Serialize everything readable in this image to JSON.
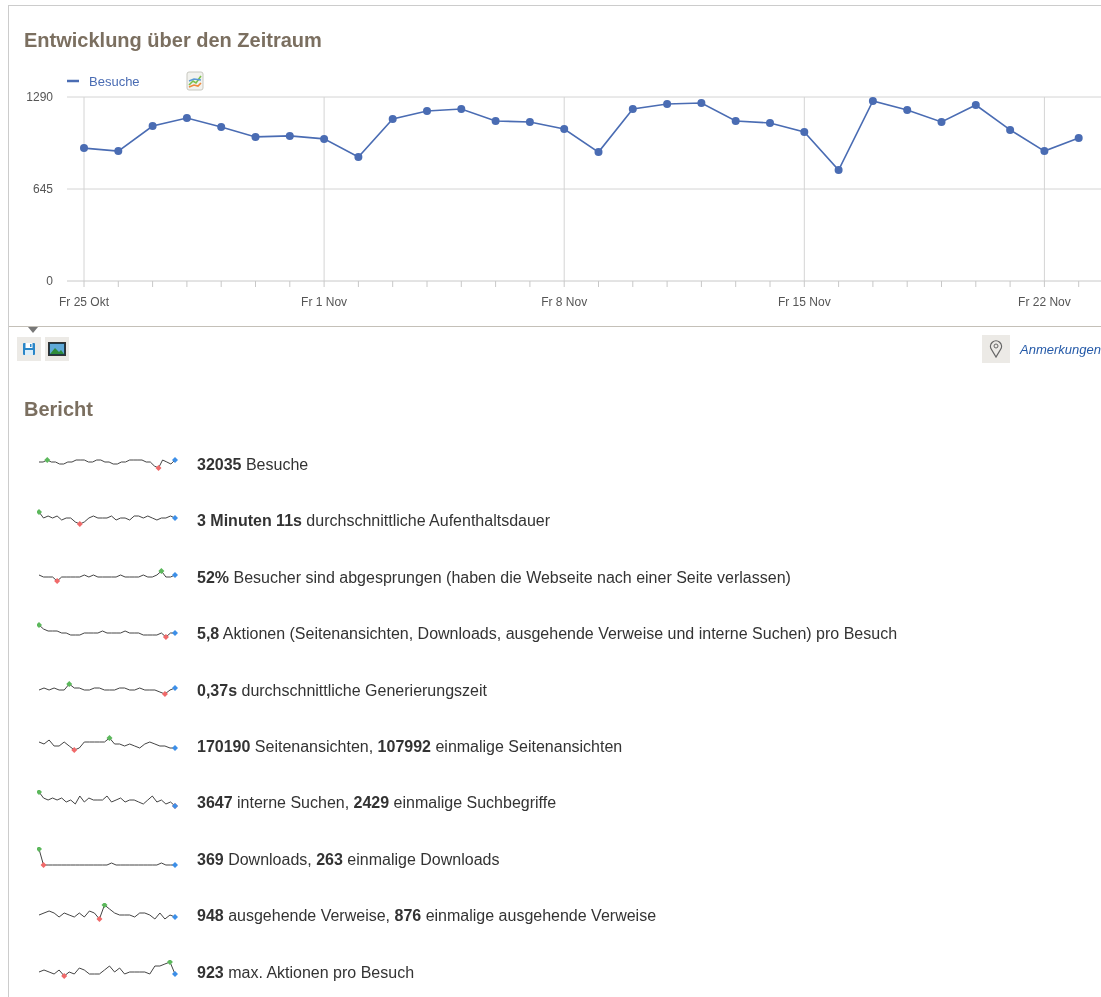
{
  "evolution": {
    "title": "Entwicklung über den Zeitraum",
    "chart_data": {
      "type": "line",
      "categories": [
        "Fr 25 Okt",
        null,
        null,
        null,
        null,
        null,
        null,
        "Fr 1 Nov",
        null,
        null,
        null,
        null,
        null,
        null,
        "Fr 8 Nov",
        null,
        null,
        null,
        null,
        null,
        null,
        "Fr 15 Nov",
        null,
        null,
        null,
        null,
        null,
        null,
        "Fr 22 Nov",
        null
      ],
      "grid": true,
      "series": [
        {
          "name": "Besuche",
          "color": "#4a6cb3",
          "marker": true,
          "values": [
            932,
            911,
            1087,
            1143,
            1080,
            1010,
            1017,
            996,
            869,
            1136,
            1192,
            1206,
            1122,
            1115,
            1066,
            904,
            1206,
            1241,
            1248,
            1122,
            1108,
            1045,
            778,
            1262,
            1199,
            1115,
            1234,
            1059,
            911,
            1003
          ]
        }
      ],
      "yticks": [
        0,
        645,
        1290
      ],
      "ylim": [
        0,
        1290
      ]
    }
  },
  "toolbar": {
    "annotations_link": "Anmerkungen"
  },
  "report": {
    "title": "Bericht",
    "rows": [
      {
        "text": "**32035** Besuche"
      },
      {
        "text": "**3 Minuten 11s** durchschnittliche Aufenthaltsdauer"
      },
      {
        "text": "**52%** Besucher sind abgesprungen (haben die Webseite nach einer Seite verlassen)"
      },
      {
        "text": "**5,8** Aktionen (Seitenansichten, Downloads, ausgehende Verweise und interne Suchen) pro Besuch"
      },
      {
        "text": "**0,37s** durchschnittliche Generierungszeit"
      },
      {
        "text": "**170190** Seitenansichten, **107992** einmalige Seitenansichten"
      },
      {
        "text": "**3647** interne Suchen, **2429** einmalige Suchbegriffe"
      },
      {
        "text": "**369** Downloads, **263** einmalige Downloads"
      },
      {
        "text": "**948** ausgehende Verweise, **876** einmalige ausgehende Verweise"
      },
      {
        "text": "**923** max. Aktionen pro Besuch"
      }
    ]
  }
}
